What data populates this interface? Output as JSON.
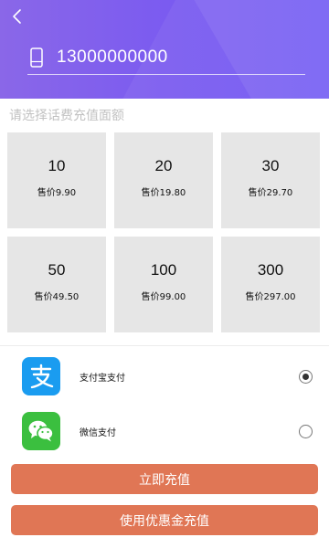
{
  "header": {
    "phone_number": "13000000000"
  },
  "section_title": "请选择话费充值面额",
  "denominations": [
    {
      "amount": "10",
      "price": "售价9.90"
    },
    {
      "amount": "20",
      "price": "售价19.80"
    },
    {
      "amount": "30",
      "price": "售价29.70"
    },
    {
      "amount": "50",
      "price": "售价49.50"
    },
    {
      "amount": "100",
      "price": "售价99.00"
    },
    {
      "amount": "300",
      "price": "售价297.00"
    }
  ],
  "payment_methods": [
    {
      "label": "支付宝支付",
      "icon": "alipay-icon",
      "selected": true
    },
    {
      "label": "微信支付",
      "icon": "wechat-pay-icon",
      "selected": false
    }
  ],
  "buttons": {
    "recharge_now": "立即充值",
    "recharge_with_coupon": "使用优惠金充值"
  },
  "colors": {
    "header_gradient_start": "#8a67e8",
    "header_gradient_end": "#6f58f4",
    "tile_background": "#e6e6e6",
    "button_color": "#e07655",
    "alipay_blue": "#1a9cf0",
    "wechat_green": "#3bbf3f"
  }
}
